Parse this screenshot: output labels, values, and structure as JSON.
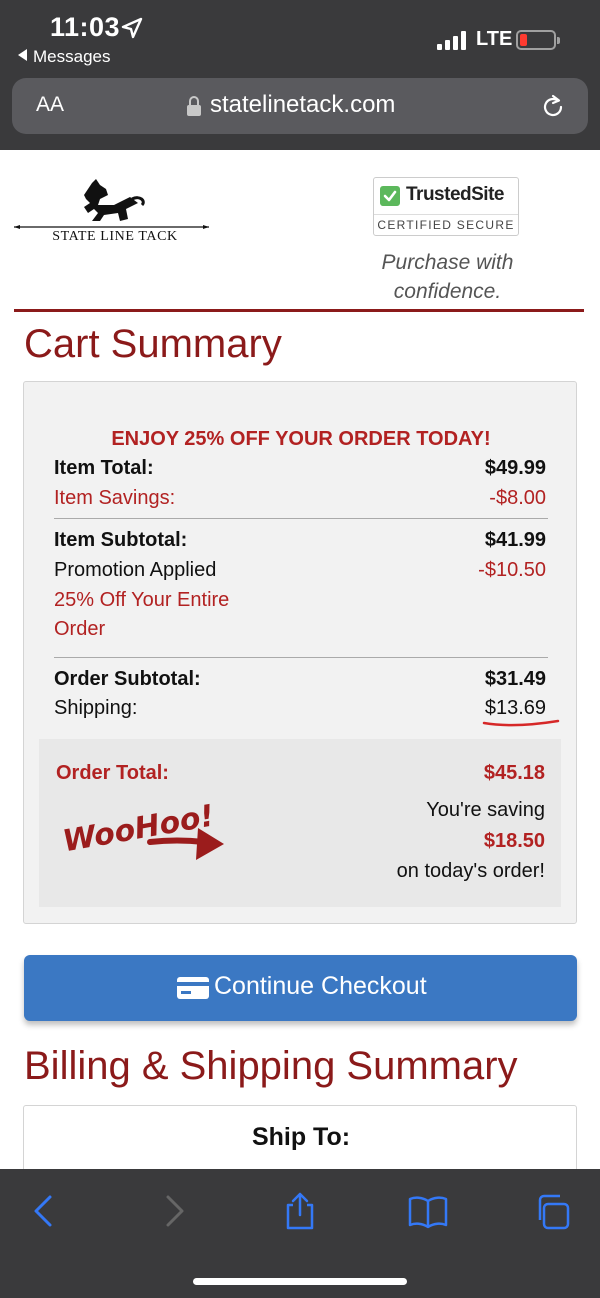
{
  "status_bar": {
    "time": "11:03",
    "back_app": "Messages",
    "network": "LTE",
    "battery_level": 0.15
  },
  "browser": {
    "aa_label": "AA",
    "url": "statelinetack.com"
  },
  "header": {
    "logo_text": "STATE LINE TACK",
    "badge_name": "TrustedSite",
    "badge_certified": "CERTIFIED SECURE",
    "confidence_line1": "Purchase with",
    "confidence_line2": "confidence."
  },
  "cart": {
    "title": "Cart Summary",
    "promo_headline": "ENJOY 25% OFF YOUR ORDER TODAY!",
    "item_total_label": "Item Total:",
    "item_total_value": "$49.99",
    "item_savings_label": "Item Savings:",
    "item_savings_value": "-$8.00",
    "item_subtotal_label": "Item Subtotal:",
    "item_subtotal_value": "$41.99",
    "promotion_label": "Promotion Applied",
    "promotion_value": "-$10.50",
    "promotion_desc_line1": "25% Off Your Entire",
    "promotion_desc_line2": "Order",
    "order_subtotal_label": "Order Subtotal:",
    "order_subtotal_value": "$31.49",
    "shipping_label": "Shipping:",
    "shipping_value": "$13.69",
    "order_total_label": "Order Total:",
    "order_total_value": "$45.18",
    "woohoo_text": "WooHoo!",
    "saving_prefix": "You're saving",
    "saving_amount": "$18.50",
    "saving_suffix": "on today's order!"
  },
  "checkout_button": {
    "label": "Continue Checkout"
  },
  "billing": {
    "title": "Billing & Shipping Summary",
    "ship_to_label": "Ship To:"
  },
  "colors": {
    "brand_red": "#8b1a1a",
    "accent_red": "#b22222",
    "button_blue": "#3b78c3",
    "chrome_dark": "#3a3a3c",
    "ios_blue": "#3478f6"
  },
  "toolbar": {
    "icons": [
      "back-icon",
      "forward-icon",
      "share-icon",
      "bookmarks-icon",
      "tabs-icon"
    ]
  }
}
